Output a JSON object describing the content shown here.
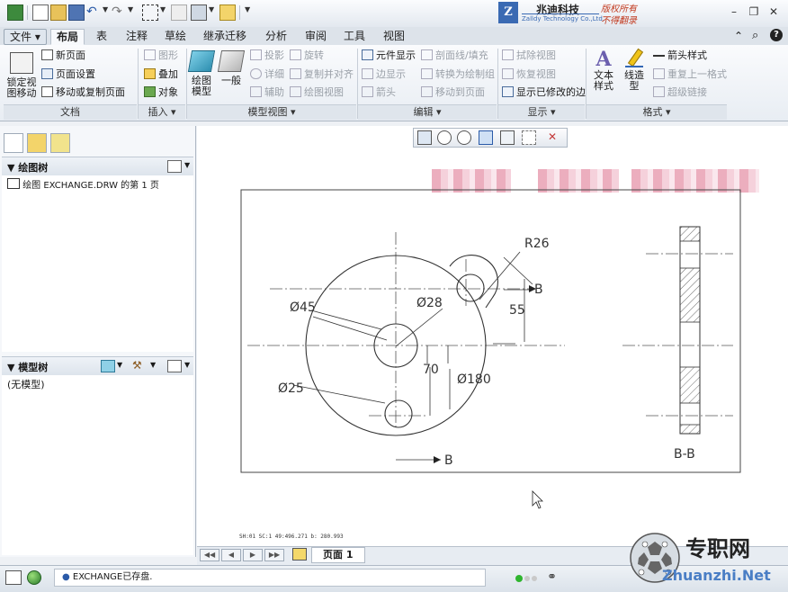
{
  "quick_access": {
    "icons": [
      "app-icon",
      "new-icon",
      "open-icon",
      "save-icon",
      "undo-icon",
      "redo-icon",
      "select-box-icon",
      "regenerate-icon",
      "windows-icon",
      "close-window-icon",
      "customize-icon"
    ]
  },
  "brand_header": {
    "logo_letter": "Z",
    "company_cn": "兆迪科技",
    "company_en": "Zalldy Technology Co.,Ltd.",
    "copyright_1": "版权所有",
    "copyright_2": "不得翻录"
  },
  "tabs": {
    "file": "文件",
    "layout": "布局",
    "table": "表",
    "annotate": "注释",
    "sketch": "草绘",
    "inherit": "继承迁移",
    "analysis": "分析",
    "review": "审阅",
    "tools": "工具",
    "view": "视图"
  },
  "ribbon": {
    "document": {
      "label": "文档",
      "lock_view_line1": "锁定视",
      "lock_view_line2": "图移动",
      "new_page": "新页面",
      "page_setup": "页面设置",
      "move_copy_page": "移动或复制页面"
    },
    "insert": {
      "label": "插入",
      "graph": "图形",
      "overlay": "叠加",
      "object": "对象"
    },
    "model_views": {
      "label": "模型视图",
      "drawing_model_line1": "绘图",
      "drawing_model_line2": "模型",
      "general": "一般",
      "projection": "投影",
      "detail": "详细",
      "auxiliary": "辅助",
      "revolve": "旋转",
      "copy_align": "复制并对齐",
      "drawing_view": "绘图视图"
    },
    "edit": {
      "label": "编辑",
      "element_display": "元件显示",
      "edge_display": "边显示",
      "arrow": "箭头",
      "section_line_fill": "剖面线/填充",
      "convert_to_group": "转换为绘制组",
      "move_to_page": "移动到页面"
    },
    "display": {
      "label": "显示",
      "erase_view": "拭除视图",
      "resume_view": "恢复视图",
      "show_modified_edges": "显示已修改的边"
    },
    "format": {
      "label": "格式",
      "text_style_line1": "文本",
      "text_style_line2": "样式",
      "line_style_line1": "线造",
      "line_style_line2": "型",
      "arrow_style": "箭头样式",
      "repeat_last_format": "重复上一格式",
      "hyperlink": "超级链接"
    }
  },
  "drawing_tree": {
    "title": "绘图树",
    "item": "绘图 EXCHANGE.DRW 的第 1 页"
  },
  "model_tree": {
    "title": "模型树",
    "item": "(无模型)"
  },
  "drawing": {
    "r26": "R26",
    "d45": "Ø45",
    "d28": "Ø28",
    "d55": "55",
    "d70": "70",
    "d180": "Ø180",
    "d25": "Ø25",
    "section_b_top": "B",
    "section_b_bottom": "B",
    "section_label": "B-B"
  },
  "coords_text": "SH:01   SC:1   49:496.271 b: 280.993",
  "page_nav": {
    "page_label": "页面 1"
  },
  "status": {
    "message": "EXCHANGE已存盘."
  },
  "footer_brand": {
    "name_cn": "专职网",
    "url": "Zhuanzhi.Net"
  }
}
